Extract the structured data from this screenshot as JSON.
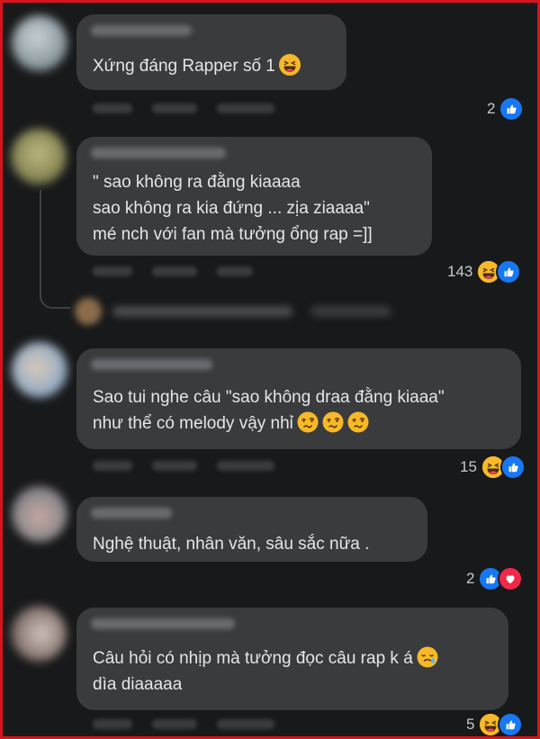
{
  "comments": [
    {
      "text_lines": [
        "Xứng đáng Rapper số 1"
      ],
      "reaction_count": "2",
      "reactions": [
        "like"
      ],
      "emoji": "laughing"
    },
    {
      "text_lines": [
        "\" sao không ra đằng kiaaaa",
        "sao không ra kia đứng ... zịa ziaaaa\"",
        "mé nch với fan mà tưởng ổng rap =]]"
      ],
      "reaction_count": "143",
      "reactions": [
        "haha",
        "like"
      ]
    },
    {
      "text_lines": [
        "Sao tui nghe câu \"sao không draa đằng kiaaa\"",
        "như thể có melody vậy nhỉ"
      ],
      "reaction_count": "15",
      "reactions": [
        "haha",
        "like"
      ],
      "emoji": "woozy"
    },
    {
      "text_lines": [
        "Nghệ thuật, nhân văn, sâu sắc nữa ."
      ],
      "reaction_count": "2",
      "reactions": [
        "like",
        "love"
      ]
    },
    {
      "text_lines": [
        "Câu hỏi có nhịp mà tưởng đọc câu rap k á",
        "dìa diaaaaa"
      ],
      "reaction_count": "5",
      "reactions": [
        "haha",
        "like"
      ],
      "emoji": "crying"
    }
  ],
  "colors": {
    "frame": "#d5141e",
    "background": "#18191a",
    "bubble": "#3a3b3c",
    "text": "#e4e6eb",
    "like": "#1877f2",
    "love": "#f02849",
    "haha": "#f7b928"
  }
}
